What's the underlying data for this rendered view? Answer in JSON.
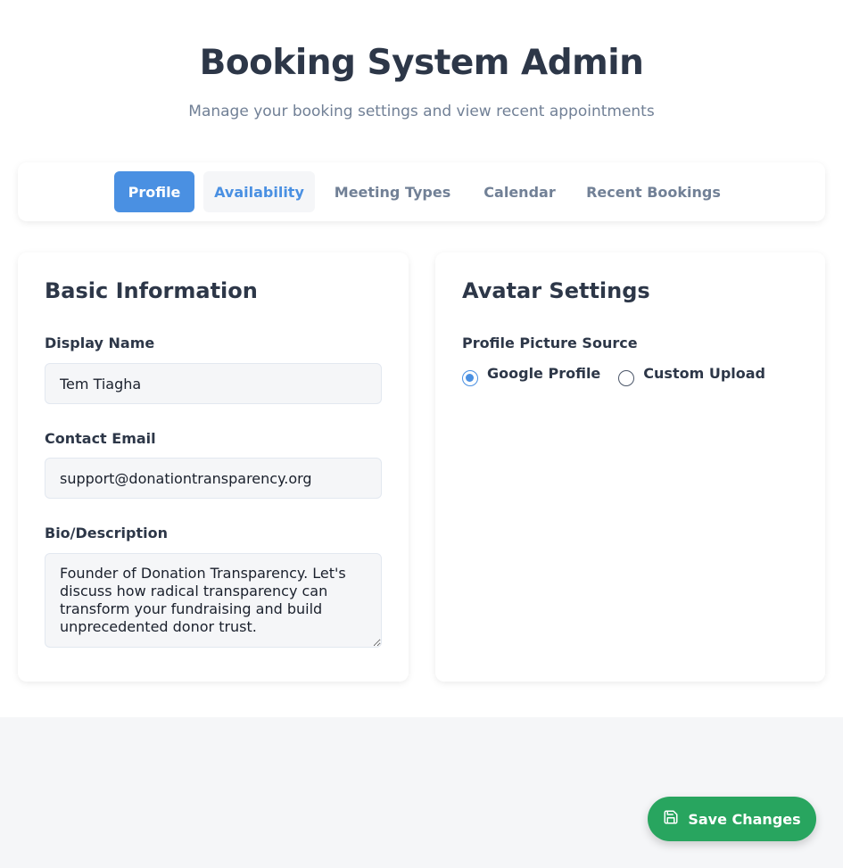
{
  "header": {
    "title": "Booking System Admin",
    "subtitle": "Manage your booking settings and view recent appointments"
  },
  "tabs": [
    {
      "label": "Profile",
      "active": true
    },
    {
      "label": "Availability",
      "active": false
    },
    {
      "label": "Meeting Types",
      "active": false
    },
    {
      "label": "Calendar",
      "active": false
    },
    {
      "label": "Recent Bookings",
      "active": false
    }
  ],
  "basic_info": {
    "heading": "Basic Information",
    "display_name_label": "Display Name",
    "display_name_value": "Tem Tiagha",
    "email_label": "Contact Email",
    "email_value": "support@donationtransparency.org",
    "bio_label": "Bio/Description",
    "bio_value": "Founder of Donation Transparency. Let's discuss how radical transparency can transform your fundraising and build unprecedented donor trust."
  },
  "avatar": {
    "heading": "Avatar Settings",
    "source_label": "Profile Picture Source",
    "options": [
      {
        "label": "Google Profile",
        "selected": true
      },
      {
        "label": "Custom Upload",
        "selected": false
      }
    ]
  },
  "save_button": {
    "label": "Save Changes",
    "icon": "save-icon"
  },
  "colors": {
    "accent": "#4a90e2",
    "success": "#28a55f",
    "text": "#2d3748",
    "muted": "#718096"
  }
}
